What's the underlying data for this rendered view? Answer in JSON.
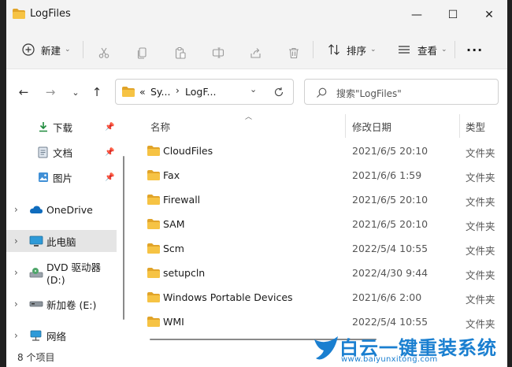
{
  "window": {
    "title": "LogFiles"
  },
  "window_controls": {
    "minimize": "—",
    "maximize": "☐",
    "close": "✕"
  },
  "toolbar": {
    "new_label": "新建",
    "sort_label": "排序",
    "view_label": "查看",
    "more_label": "···"
  },
  "address": {
    "prefix": "«",
    "crumbs": [
      "Sy...",
      "LogF..."
    ]
  },
  "search": {
    "placeholder": "搜索\"LogFiles\""
  },
  "sidebar": {
    "items": [
      {
        "label": "下载",
        "icon": "download-icon",
        "pinned": true
      },
      {
        "label": "文档",
        "icon": "document-icon",
        "pinned": true
      },
      {
        "label": "图片",
        "icon": "picture-icon",
        "pinned": true
      },
      {
        "label": "OneDrive",
        "icon": "cloud-icon",
        "pinned": false
      },
      {
        "label": "此电脑",
        "icon": "computer-icon",
        "pinned": false,
        "selected": true
      },
      {
        "label": "DVD 驱动器 (D:)",
        "icon": "dvd-drive-icon",
        "pinned": false
      },
      {
        "label": "新加卷 (E:)",
        "icon": "drive-icon",
        "pinned": false
      },
      {
        "label": "网络",
        "icon": "network-icon",
        "pinned": false
      }
    ]
  },
  "columns": {
    "name": "名称",
    "date": "修改日期",
    "type": "类型"
  },
  "files": [
    {
      "name": "CloudFiles",
      "date": "2021/6/5 20:10",
      "type": "文件夹"
    },
    {
      "name": "Fax",
      "date": "2021/6/6 1:59",
      "type": "文件夹"
    },
    {
      "name": "Firewall",
      "date": "2021/6/5 20:10",
      "type": "文件夹"
    },
    {
      "name": "SAM",
      "date": "2021/6/5 20:10",
      "type": "文件夹"
    },
    {
      "name": "Scm",
      "date": "2022/5/4 10:55",
      "type": "文件夹"
    },
    {
      "name": "setupcln",
      "date": "2022/4/30 9:44",
      "type": "文件夹"
    },
    {
      "name": "Windows Portable Devices",
      "date": "2021/6/6 2:00",
      "type": "文件夹"
    },
    {
      "name": "WMI",
      "date": "2022/5/4 10:55",
      "type": "文件夹"
    }
  ],
  "status": {
    "item_count": "8 个项目"
  },
  "watermark": {
    "title": "白云一键重装系统",
    "url": "www.baiyunxitong.com"
  },
  "colors": {
    "folder": "#f6c344",
    "folder_dark": "#e1a429",
    "accent": "#1a7fd0"
  }
}
